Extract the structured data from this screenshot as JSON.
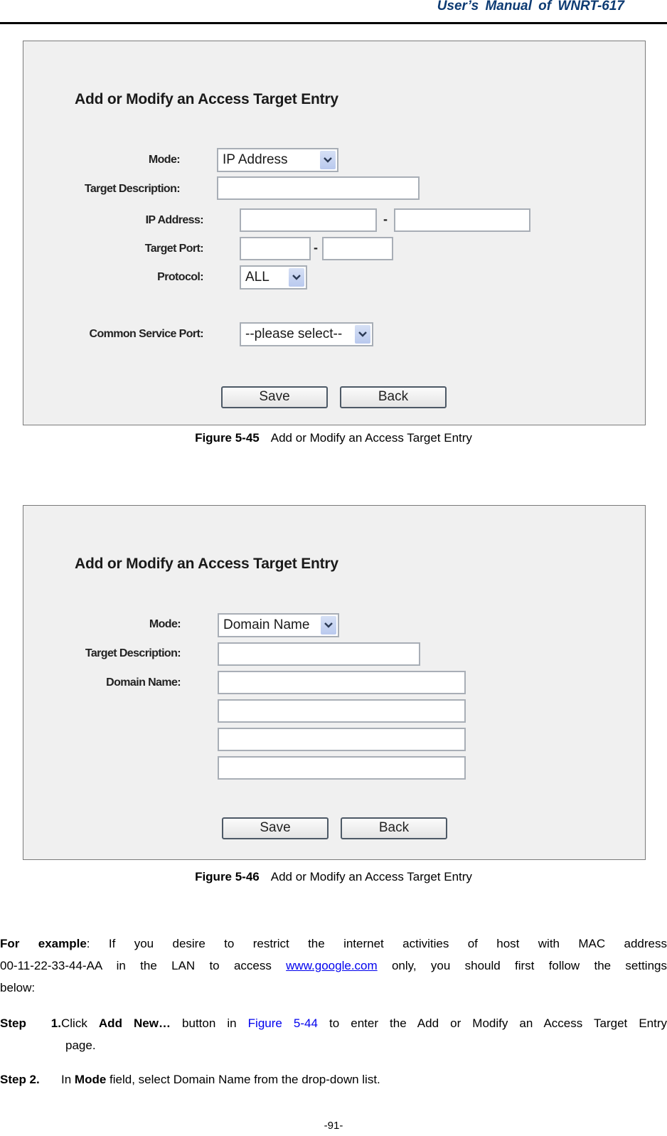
{
  "header": {
    "manual_title": "User’s  Manual  of  WNRT-617"
  },
  "figures": [
    {
      "form_title": "Add or Modify an Access Target Entry",
      "labels": {
        "mode": "Mode:",
        "target_description": "Target Description:",
        "ip_address": "IP Address:",
        "target_port": "Target Port:",
        "protocol": "Protocol:",
        "common_service_port": "Common Service Port:"
      },
      "mode_value": "IP Address",
      "protocol_value": "ALL",
      "common_service_port_value": "--please select--",
      "range_separator": "-",
      "buttons": {
        "save": "Save",
        "back": "Back"
      },
      "caption_number": "Figure 5-45",
      "caption_text": "Add or Modify an Access Target Entry"
    },
    {
      "form_title": "Add or Modify an Access Target Entry",
      "labels": {
        "mode": "Mode:",
        "target_description": "Target Description:",
        "domain_name": "Domain Name:"
      },
      "mode_value": "Domain Name",
      "buttons": {
        "save": "Save",
        "back": "Back"
      },
      "caption_number": "Figure 5-46",
      "caption_text": "Add or Modify an Access Target Entry"
    }
  ],
  "body": {
    "example_label": "For example",
    "example_line1": ": If you desire to restrict the internet activities of host with MAC address",
    "example_line2_pre": "00-11-22-33-44-AA in the LAN to access ",
    "example_link": "www.google.com",
    "example_line2_post": " only, you should first follow the settings",
    "example_line3": "below:",
    "steps": [
      {
        "label": "Step 1.",
        "pre": "Click ",
        "bold": "Add New…",
        "mid": " button in ",
        "ref": "Figure 5-44",
        "post": " to enter the Add or Modify an Access Target Entry",
        "cont": "page."
      },
      {
        "label": "Step 2.",
        "pre": "In ",
        "bold": "Mode",
        "post": " field, select Domain Name from the drop-down list."
      }
    ]
  },
  "footer": {
    "page_number": "-91-"
  }
}
